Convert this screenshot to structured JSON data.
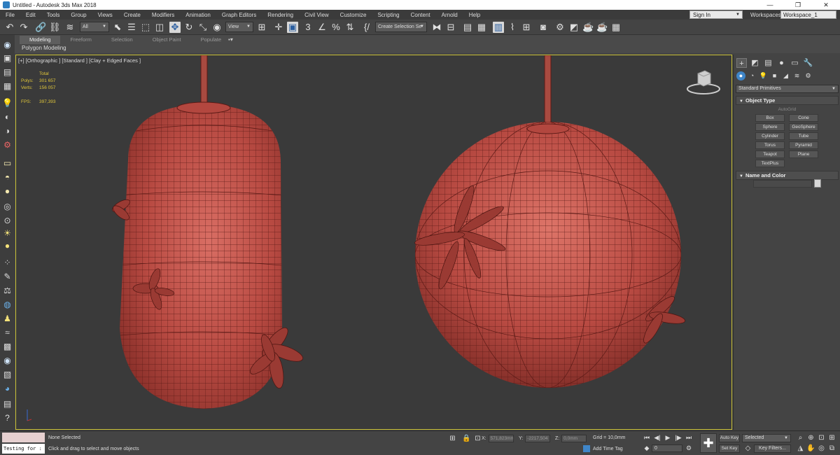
{
  "window": {
    "title": "Untitled - Autodesk 3ds Max 2018",
    "minimize": "—",
    "maximize": "❐",
    "close": "✕"
  },
  "menu": [
    "File",
    "Edit",
    "Tools",
    "Group",
    "Views",
    "Create",
    "Modifiers",
    "Animation",
    "Graph Editors",
    "Rendering",
    "Civil View",
    "Customize",
    "Scripting",
    "Content",
    "Arnold",
    "Help"
  ],
  "account": {
    "signin": "Sign In",
    "workspaces_label": "Workspaces:",
    "workspace": "Workspace_1"
  },
  "toolbar": {
    "selection_filter": "All",
    "reference_coord": "View",
    "named_selection": "Create Selection Se",
    "snap_3": "3",
    "angle_snap": "∠",
    "percent_snap": "%"
  },
  "ribbon": {
    "tabs": [
      "Modeling",
      "Freeform",
      "Selection",
      "Object Paint",
      "Populate"
    ],
    "extra": "▪▾",
    "subtitle": "Polygon Modeling"
  },
  "viewport": {
    "label": "[+] [Orthographic ] [Standard ] [Clay + Edged Faces ]",
    "stats": {
      "header": "Total",
      "polys_label": "Polys:",
      "polys": "301 657",
      "verts_label": "Verts:",
      "verts": "156 057",
      "fps_label": "FPS:",
      "fps": "397,393"
    },
    "mesh_color": "#b84a42"
  },
  "command_panel": {
    "category": "Standard Primitives",
    "object_type_title": "Object Type",
    "autogrid": "AutoGrid",
    "primitives": [
      "Box",
      "Cone",
      "Sphere",
      "GeoSphere",
      "Cylinder",
      "Tube",
      "Torus",
      "Pyramid",
      "Teapot",
      "Plane",
      "TextPlus"
    ],
    "name_color_title": "Name and Color"
  },
  "status": {
    "none_selected": "None Selected",
    "prompt": "Click and drag to select and move objects",
    "maxscript": "Testing for :",
    "x_label": "X:",
    "x_value": "571,823mm",
    "y_label": "Y:",
    "y_value": "-2217,504",
    "z_label": "Z:",
    "z_value": "0,0mm",
    "grid": "Grid = 10,0mm",
    "add_time_tag": "Add Time Tag",
    "frame": "0",
    "auto_key": "Auto Key",
    "set_key": "Set Key",
    "selected": "Selected",
    "key_filters": "Key Filters..."
  },
  "colors": {
    "accent": "#3f86c9",
    "viewport_border": "#c9c035",
    "stats": "#e0c63a"
  }
}
